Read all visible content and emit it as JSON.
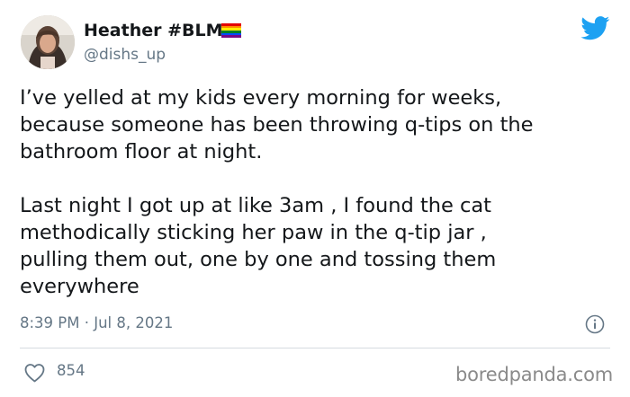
{
  "user": {
    "display_name": "Heather #BLM",
    "handle": "@dishs_up",
    "avatar_icon": "profile-photo",
    "flag_icon": "rainbow-flag-icon",
    "flag_colors": [
      "#e40303",
      "#ff8c00",
      "#ffed00",
      "#008026",
      "#004dff",
      "#750787"
    ]
  },
  "brand": {
    "icon": "twitter-bird-icon",
    "color": "#1da1f2"
  },
  "tweet": {
    "paragraph1": [
      "I’ve yelled at my kids every morning for weeks,",
      "because someone has been throwing q-tips on the",
      "bathroom floor at night."
    ],
    "paragraph2": [
      "Last night I got up at like 3am , I found the cat",
      "methodically sticking her paw in the q-tip jar ,",
      "pulling them out, one by one and tossing them",
      "everywhere"
    ]
  },
  "meta": {
    "timestamp": "8:39 PM · Jul 8, 2021",
    "info_icon": "info-icon"
  },
  "engagement": {
    "like_icon": "heart-icon",
    "like_count": "854"
  },
  "watermark": "boredpanda.com"
}
